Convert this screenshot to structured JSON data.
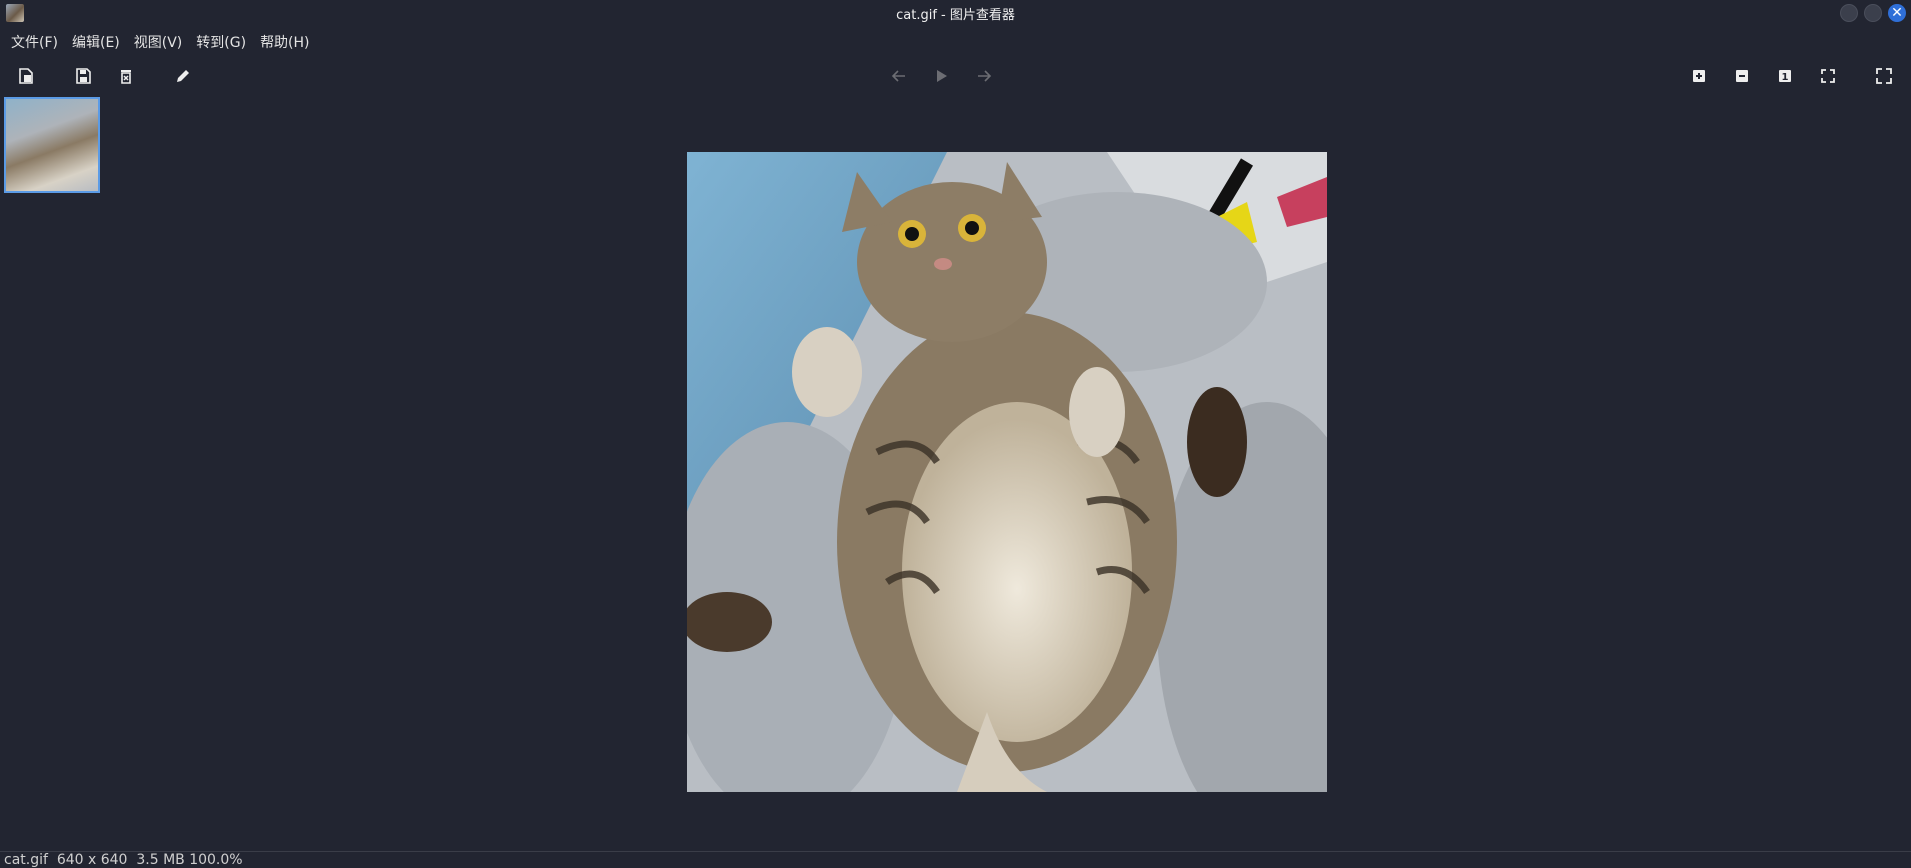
{
  "window": {
    "title": "cat.gif - 图片查看器",
    "close_symbol": "✕"
  },
  "menu": {
    "items": [
      "文件(F)",
      "编辑(E)",
      "视图(V)",
      "转到(G)",
      "帮助(H)"
    ]
  },
  "toolbar": {
    "left_icons": [
      "open-icon",
      "save-icon",
      "delete-icon",
      "edit-icon"
    ],
    "nav_icons": [
      "arrow-left-icon",
      "play-icon",
      "arrow-right-icon"
    ],
    "right_icons": [
      "zoom-in-icon",
      "zoom-out-icon",
      "original-size-icon",
      "fit-window-icon",
      "fullscreen-icon"
    ],
    "original_size_glyph": "1"
  },
  "image": {
    "subject": "tabby cat lying on its back on grey cushions"
  },
  "status": {
    "text": "cat.gif  640 x 640  3.5 MB 100.0%"
  },
  "colors": {
    "background": "#222531",
    "accent": "#2f6fd8",
    "thumb_border": "#5b9be6"
  }
}
